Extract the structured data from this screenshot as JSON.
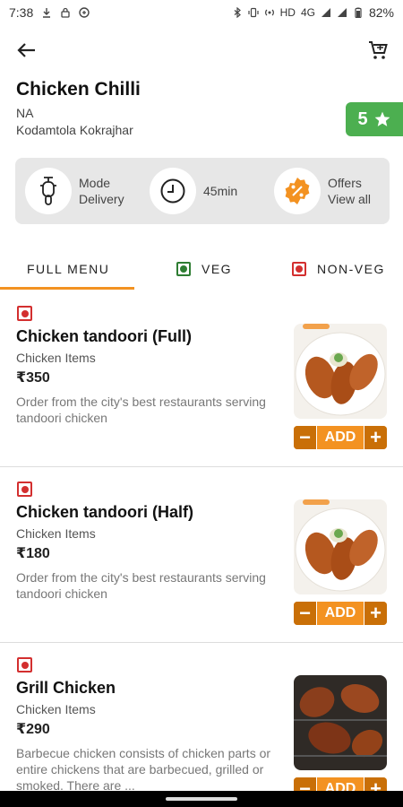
{
  "status_bar": {
    "time": "7:38",
    "network_label": "HD",
    "signal_label": "4G",
    "battery": "82%"
  },
  "restaurant": {
    "name": "Chicken Chilli",
    "subtitle": "NA",
    "address": "Kodamtola Kokrajhar",
    "rating": "5"
  },
  "info_card": {
    "mode_line1": "Mode",
    "mode_line2": "Delivery",
    "time": "45min",
    "offers_line1": "Offers",
    "offers_line2": "View all"
  },
  "tabs": [
    {
      "label": "FULL MENU"
    },
    {
      "label": "VEG"
    },
    {
      "label": "NON-VEG"
    }
  ],
  "menu": [
    {
      "title": "Chicken tandoori (Full)",
      "category": "Chicken Items",
      "price": "₹350",
      "description": "Order from the city's best restaurants serving tandoori chicken",
      "add_label": "ADD"
    },
    {
      "title": "Chicken tandoori (Half)",
      "category": "Chicken Items",
      "price": "₹180",
      "description": "Order from the city's best restaurants serving tandoori chicken",
      "add_label": "ADD"
    },
    {
      "title": "Grill Chicken",
      "category": "Chicken Items",
      "price": "₹290",
      "description": "Barbecue chicken consists of chicken parts or entire chickens that are barbecued, grilled or smoked. There are ...",
      "add_label": "ADD"
    }
  ],
  "colors": {
    "accent": "#f39221",
    "accent_dark": "#c96f07",
    "rating_green": "#4caf50",
    "veg_green": "#2e7d32",
    "nonveg_red": "#d32f2f"
  },
  "icons": {
    "back": "arrow-left-icon",
    "cart": "cart-icon",
    "mode": "scooter-icon",
    "time": "clock-icon",
    "offers": "discount-icon",
    "rating": "star-icon"
  }
}
